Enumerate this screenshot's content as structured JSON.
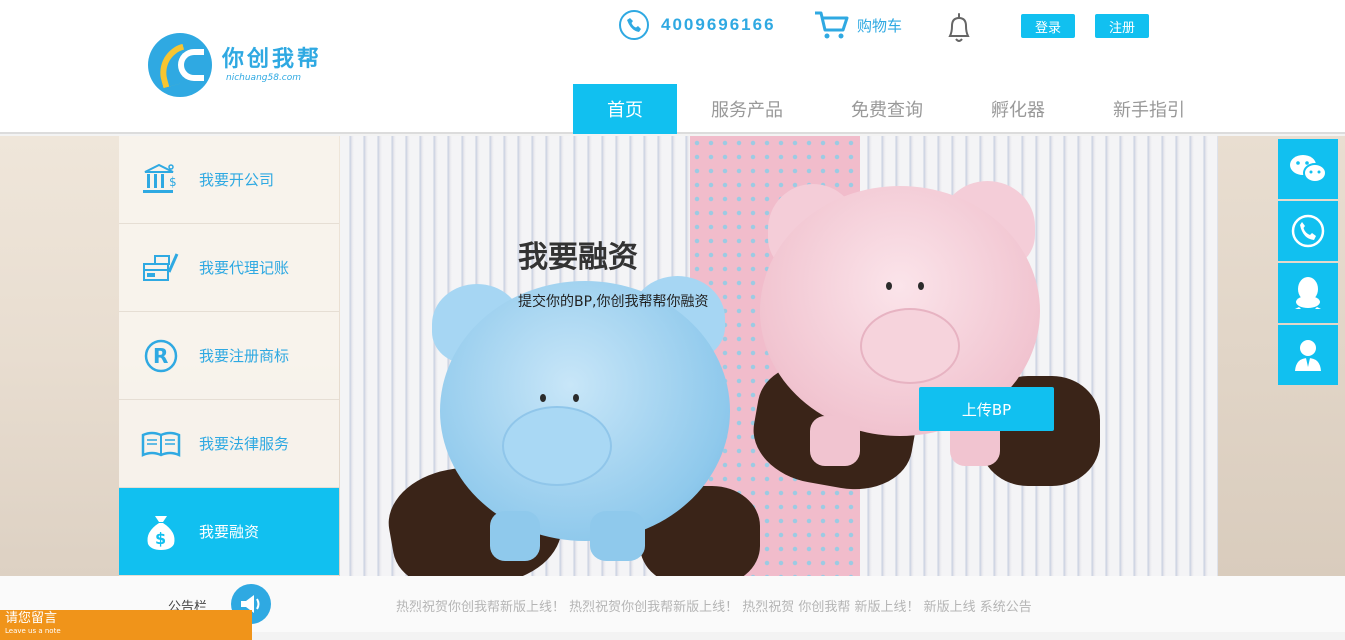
{
  "header": {
    "logo_title": "你创我帮",
    "logo_sub": "nichuang58.com",
    "phone": "4009696166",
    "cart_label": "购物车",
    "login_label": "登录",
    "register_label": "注册"
  },
  "nav": {
    "items": [
      {
        "label": "首页",
        "active": true
      },
      {
        "label": "服务产品"
      },
      {
        "label": "免费查询"
      },
      {
        "label": "孵化器"
      },
      {
        "label": "新手指引"
      }
    ]
  },
  "sidebar": {
    "items": [
      {
        "label": "我要开公司",
        "icon": "bank-icon"
      },
      {
        "label": "我要代理记账",
        "icon": "ledger-icon"
      },
      {
        "label": "我要注册商标",
        "icon": "registered-trademark-icon"
      },
      {
        "label": "我要法律服务",
        "icon": "book-icon"
      },
      {
        "label": "我要融资",
        "icon": "money-bag-icon",
        "active": true
      }
    ]
  },
  "hero": {
    "title": "我要融资",
    "description": "提交你的BP,你创我帮帮你融资",
    "button_label": "上传BP"
  },
  "float_bar": {
    "items": [
      "wechat-icon",
      "phone-icon",
      "qq-icon",
      "customer-service-icon"
    ]
  },
  "notice": {
    "label": "公告栏",
    "text": "热烈祝贺你创我帮新版上线！ 热烈祝贺你创我帮新版上线！ 热烈祝贺 你创我帮 新版上线！ 新版上线 系统公告"
  },
  "message_tab": {
    "title": "请您留言",
    "subtitle": "Leave us a note"
  },
  "colors": {
    "accent": "#11c0f0",
    "brand_blue": "#2fa9e2",
    "message_orange": "#f0941a"
  }
}
